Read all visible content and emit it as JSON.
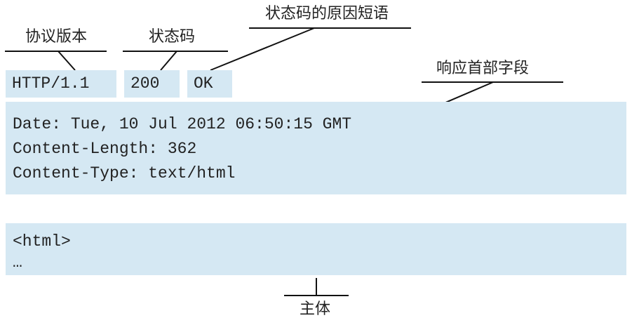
{
  "labels": {
    "version": "协议版本",
    "status_code": "状态码",
    "reason_phrase": "状态码的原因短语",
    "response_headers": "响应首部字段",
    "body": "主体"
  },
  "status_line": {
    "version": "HTTP/1.1",
    "code": "200",
    "reason": "OK"
  },
  "headers": [
    "Date: Tue, 10 Jul 2012 06:50:15 GMT",
    "Content-Length: 362",
    "Content-Type: text/html"
  ],
  "body_lines": [
    "<html>",
    "…"
  ],
  "colors": {
    "cell_background": "#d5e8f3",
    "text": "#222222",
    "line": "#111111"
  }
}
